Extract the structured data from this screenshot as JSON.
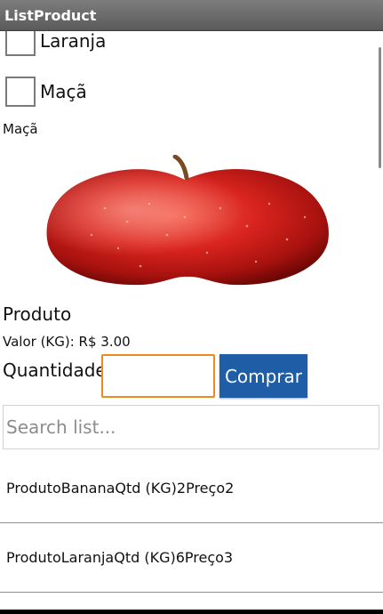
{
  "titlebar": {
    "title": "ListProduct"
  },
  "checklist": [
    {
      "label": "Laranja"
    },
    {
      "label": "Maçã"
    }
  ],
  "selected_name": "Maçã",
  "product": {
    "title": "Produto",
    "price": "Valor (KG): R$ 3.00"
  },
  "quantity": {
    "label": "Quantidade",
    "value": ""
  },
  "buy_button": {
    "label": "Comprar",
    "color": "#1f5da7"
  },
  "search": {
    "placeholder": "Search list..."
  },
  "list_items": [
    {
      "text": "ProdutoBananaQtd (KG)2Preço2"
    },
    {
      "text": "ProdutoLaranjaQtd (KG)6Preço3"
    }
  ],
  "colors": {
    "titlebar": "#6b6b6b",
    "input_focus": "#ef8a1c",
    "apple": "#d9241e"
  }
}
